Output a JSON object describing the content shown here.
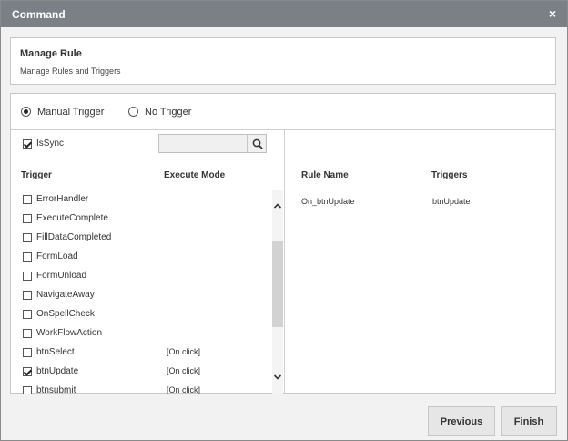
{
  "window": {
    "title": "Command",
    "close_glyph": "×"
  },
  "header": {
    "title": "Manage Rule",
    "subtitle": "Manage Rules and Triggers"
  },
  "trigger_options": [
    {
      "label": "Manual Trigger",
      "selected": true
    },
    {
      "label": "No Trigger",
      "selected": false
    }
  ],
  "issync": {
    "label": "IsSync",
    "checked": true
  },
  "search": {
    "value": "",
    "icon": "search-icon"
  },
  "trigger_list": {
    "columns": {
      "trigger": "Trigger",
      "execute_mode": "Execute Mode"
    },
    "items": [
      {
        "name": "ErrorHandler",
        "mode": "",
        "checked": false
      },
      {
        "name": "ExecuteComplete",
        "mode": "",
        "checked": false
      },
      {
        "name": "FillDataCompleted",
        "mode": "",
        "checked": false
      },
      {
        "name": "FormLoad",
        "mode": "",
        "checked": false
      },
      {
        "name": "FormUnload",
        "mode": "",
        "checked": false
      },
      {
        "name": "NavigateAway",
        "mode": "",
        "checked": false
      },
      {
        "name": "OnSpellCheck",
        "mode": "",
        "checked": false
      },
      {
        "name": "WorkFlowAction",
        "mode": "",
        "checked": false
      },
      {
        "name": "btnSelect",
        "mode": "[On click]",
        "checked": false
      },
      {
        "name": "btnUpdate",
        "mode": "[On click]",
        "checked": true
      },
      {
        "name": "btnsubmit",
        "mode": "[On click]",
        "checked": false
      }
    ]
  },
  "rules": {
    "columns": {
      "rule_name": "Rule Name",
      "triggers": "Triggers"
    },
    "rows": [
      {
        "rule_name": "On_btnUpdate",
        "triggers": "btnUpdate"
      }
    ]
  },
  "footer": {
    "previous": "Previous",
    "finish": "Finish"
  }
}
